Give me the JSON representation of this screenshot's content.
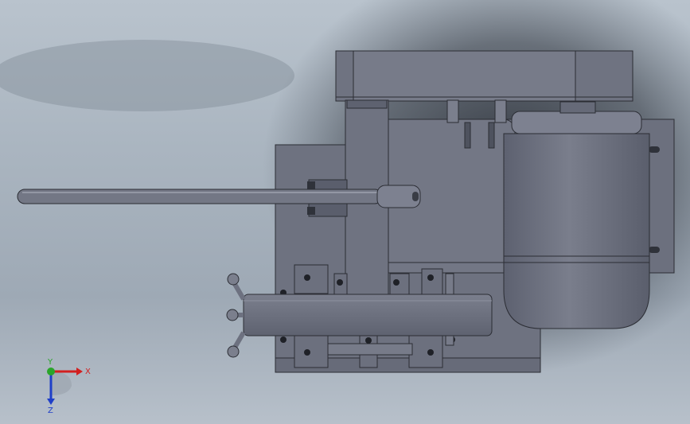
{
  "viewport": {
    "background_top": "#b9c3cd",
    "background_bottom": "#aab5c0",
    "part_color": "#6d7180",
    "part_highlight": "#8a8e9c",
    "edge_color": "#2a2c33"
  },
  "triad": {
    "x_label": "X",
    "y_label": "Y",
    "z_label": "Z",
    "x_color": "#d21f1f",
    "y_color": "#2aa52a",
    "z_color": "#1f3fc8"
  }
}
